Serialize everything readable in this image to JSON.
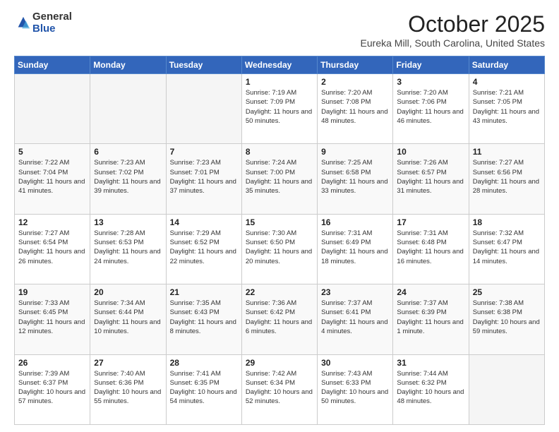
{
  "logo": {
    "general": "General",
    "blue": "Blue"
  },
  "header": {
    "month": "October 2025",
    "location": "Eureka Mill, South Carolina, United States"
  },
  "weekdays": [
    "Sunday",
    "Monday",
    "Tuesday",
    "Wednesday",
    "Thursday",
    "Friday",
    "Saturday"
  ],
  "weeks": [
    [
      {
        "day": "",
        "info": ""
      },
      {
        "day": "",
        "info": ""
      },
      {
        "day": "",
        "info": ""
      },
      {
        "day": "1",
        "info": "Sunrise: 7:19 AM\nSunset: 7:09 PM\nDaylight: 11 hours and 50 minutes."
      },
      {
        "day": "2",
        "info": "Sunrise: 7:20 AM\nSunset: 7:08 PM\nDaylight: 11 hours and 48 minutes."
      },
      {
        "day": "3",
        "info": "Sunrise: 7:20 AM\nSunset: 7:06 PM\nDaylight: 11 hours and 46 minutes."
      },
      {
        "day": "4",
        "info": "Sunrise: 7:21 AM\nSunset: 7:05 PM\nDaylight: 11 hours and 43 minutes."
      }
    ],
    [
      {
        "day": "5",
        "info": "Sunrise: 7:22 AM\nSunset: 7:04 PM\nDaylight: 11 hours and 41 minutes."
      },
      {
        "day": "6",
        "info": "Sunrise: 7:23 AM\nSunset: 7:02 PM\nDaylight: 11 hours and 39 minutes."
      },
      {
        "day": "7",
        "info": "Sunrise: 7:23 AM\nSunset: 7:01 PM\nDaylight: 11 hours and 37 minutes."
      },
      {
        "day": "8",
        "info": "Sunrise: 7:24 AM\nSunset: 7:00 PM\nDaylight: 11 hours and 35 minutes."
      },
      {
        "day": "9",
        "info": "Sunrise: 7:25 AM\nSunset: 6:58 PM\nDaylight: 11 hours and 33 minutes."
      },
      {
        "day": "10",
        "info": "Sunrise: 7:26 AM\nSunset: 6:57 PM\nDaylight: 11 hours and 31 minutes."
      },
      {
        "day": "11",
        "info": "Sunrise: 7:27 AM\nSunset: 6:56 PM\nDaylight: 11 hours and 28 minutes."
      }
    ],
    [
      {
        "day": "12",
        "info": "Sunrise: 7:27 AM\nSunset: 6:54 PM\nDaylight: 11 hours and 26 minutes."
      },
      {
        "day": "13",
        "info": "Sunrise: 7:28 AM\nSunset: 6:53 PM\nDaylight: 11 hours and 24 minutes."
      },
      {
        "day": "14",
        "info": "Sunrise: 7:29 AM\nSunset: 6:52 PM\nDaylight: 11 hours and 22 minutes."
      },
      {
        "day": "15",
        "info": "Sunrise: 7:30 AM\nSunset: 6:50 PM\nDaylight: 11 hours and 20 minutes."
      },
      {
        "day": "16",
        "info": "Sunrise: 7:31 AM\nSunset: 6:49 PM\nDaylight: 11 hours and 18 minutes."
      },
      {
        "day": "17",
        "info": "Sunrise: 7:31 AM\nSunset: 6:48 PM\nDaylight: 11 hours and 16 minutes."
      },
      {
        "day": "18",
        "info": "Sunrise: 7:32 AM\nSunset: 6:47 PM\nDaylight: 11 hours and 14 minutes."
      }
    ],
    [
      {
        "day": "19",
        "info": "Sunrise: 7:33 AM\nSunset: 6:45 PM\nDaylight: 11 hours and 12 minutes."
      },
      {
        "day": "20",
        "info": "Sunrise: 7:34 AM\nSunset: 6:44 PM\nDaylight: 11 hours and 10 minutes."
      },
      {
        "day": "21",
        "info": "Sunrise: 7:35 AM\nSunset: 6:43 PM\nDaylight: 11 hours and 8 minutes."
      },
      {
        "day": "22",
        "info": "Sunrise: 7:36 AM\nSunset: 6:42 PM\nDaylight: 11 hours and 6 minutes."
      },
      {
        "day": "23",
        "info": "Sunrise: 7:37 AM\nSunset: 6:41 PM\nDaylight: 11 hours and 4 minutes."
      },
      {
        "day": "24",
        "info": "Sunrise: 7:37 AM\nSunset: 6:39 PM\nDaylight: 11 hours and 1 minute."
      },
      {
        "day": "25",
        "info": "Sunrise: 7:38 AM\nSunset: 6:38 PM\nDaylight: 10 hours and 59 minutes."
      }
    ],
    [
      {
        "day": "26",
        "info": "Sunrise: 7:39 AM\nSunset: 6:37 PM\nDaylight: 10 hours and 57 minutes."
      },
      {
        "day": "27",
        "info": "Sunrise: 7:40 AM\nSunset: 6:36 PM\nDaylight: 10 hours and 55 minutes."
      },
      {
        "day": "28",
        "info": "Sunrise: 7:41 AM\nSunset: 6:35 PM\nDaylight: 10 hours and 54 minutes."
      },
      {
        "day": "29",
        "info": "Sunrise: 7:42 AM\nSunset: 6:34 PM\nDaylight: 10 hours and 52 minutes."
      },
      {
        "day": "30",
        "info": "Sunrise: 7:43 AM\nSunset: 6:33 PM\nDaylight: 10 hours and 50 minutes."
      },
      {
        "day": "31",
        "info": "Sunrise: 7:44 AM\nSunset: 6:32 PM\nDaylight: 10 hours and 48 minutes."
      },
      {
        "day": "",
        "info": ""
      }
    ]
  ]
}
